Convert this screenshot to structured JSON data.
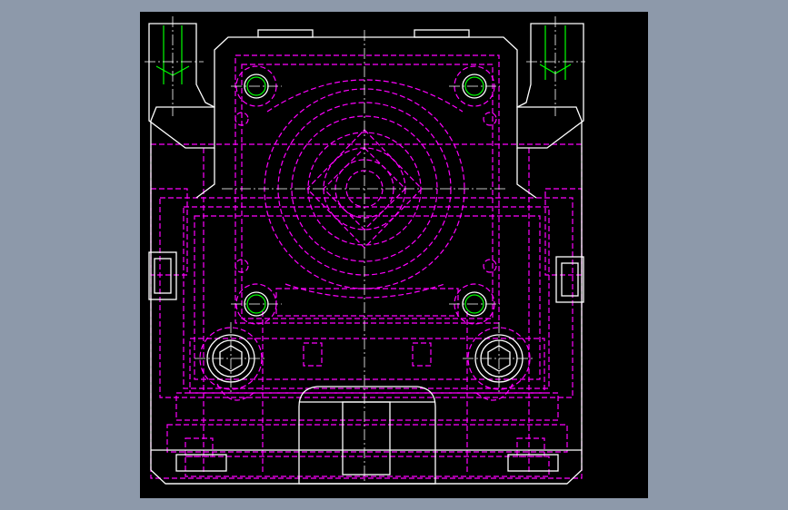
{
  "background_color": "#8d99aa",
  "viewport": {
    "background_color": "#000000"
  },
  "colors": {
    "outline": "#ffffff",
    "hidden_lines": "#ff00ff",
    "centerlines": "#ffffff",
    "threads": "#00ff00"
  },
  "drawing": {
    "view": "front",
    "line_types": [
      "solid",
      "dashed",
      "center"
    ]
  }
}
